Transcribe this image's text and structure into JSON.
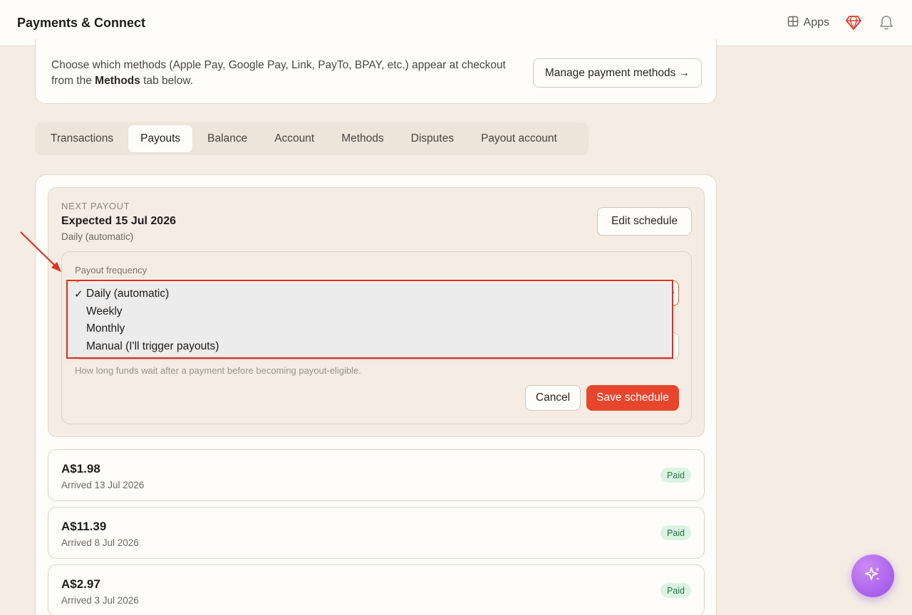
{
  "header": {
    "title": "Payments & Connect",
    "apps_label": "Apps"
  },
  "info": {
    "text_before": "Choose which methods (Apple Pay, Google Pay, Link, PayTo, BPAY, etc.) appear at checkout from the ",
    "text_bold": "Methods",
    "text_after": " tab below.",
    "manage_button": "Manage payment methods →"
  },
  "tabs": [
    {
      "label": "Transactions",
      "active": false
    },
    {
      "label": "Payouts",
      "active": true
    },
    {
      "label": "Balance",
      "active": false
    },
    {
      "label": "Account",
      "active": false
    },
    {
      "label": "Methods",
      "active": false
    },
    {
      "label": "Disputes",
      "active": false
    },
    {
      "label": "Payout account",
      "active": false
    }
  ],
  "next_payout": {
    "label": "NEXT PAYOUT",
    "title": "Expected 15 Jul 2026",
    "subtitle": "Daily (automatic)",
    "edit_button": "Edit schedule"
  },
  "schedule": {
    "frequency_label": "Payout frequency",
    "options": [
      "Daily (automatic)",
      "Weekly",
      "Monthly",
      "Manual (I'll trigger payouts)"
    ],
    "selected": "Daily (automatic)",
    "delay_help": "How long funds wait after a payment before becoming payout-eligible.",
    "cancel_button": "Cancel",
    "save_button": "Save schedule"
  },
  "payouts": [
    {
      "amount": "A$1.98",
      "date": "Arrived 13 Jul 2026",
      "status": "Paid"
    },
    {
      "amount": "A$11.39",
      "date": "Arrived 8 Jul 2026",
      "status": "Paid"
    },
    {
      "amount": "A$2.97",
      "date": "Arrived 3 Jul 2026",
      "status": "Paid"
    }
  ],
  "colors": {
    "accent": "#e8462c",
    "highlight": "#e0301e",
    "paid_badge_bg": "#dcf3e2",
    "paid_badge_text": "#257a43",
    "fab": "#9b4fe8"
  },
  "icons": {
    "apps": "grid-icon",
    "gem": "gem-icon",
    "bell": "bell-icon",
    "fab": "sparkles-icon"
  }
}
